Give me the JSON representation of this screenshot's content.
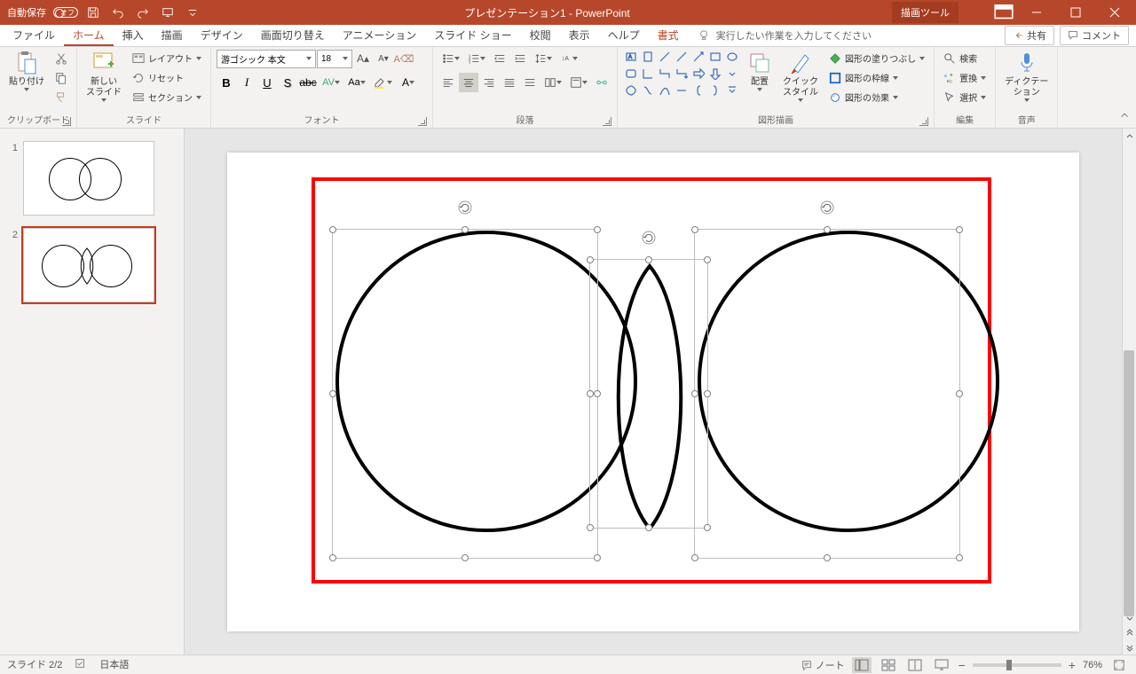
{
  "titlebar": {
    "autosave_label": "自動保存",
    "autosave_state": "オフ",
    "doc_title": "プレゼンテーション1  -  PowerPoint",
    "tools_tab": "描画ツール"
  },
  "tabs": {
    "file": "ファイル",
    "home": "ホーム",
    "insert": "挿入",
    "draw": "描画",
    "design": "デザイン",
    "transitions": "画面切り替え",
    "animations": "アニメーション",
    "slideshow": "スライド ショー",
    "review": "校閲",
    "view": "表示",
    "help": "ヘルプ",
    "format": "書式",
    "tellme": "実行したい作業を入力してください",
    "share": "共有",
    "comments": "コメント"
  },
  "ribbon": {
    "clipboard": {
      "paste": "貼り付け",
      "label": "クリップボード"
    },
    "slides": {
      "new_slide": "新しい\nスライド",
      "layout": "レイアウト",
      "reset": "リセット",
      "section": "セクション",
      "label": "スライド"
    },
    "font": {
      "name": "游ゴシック 本文",
      "size": "18",
      "label": "フォント"
    },
    "paragraph": {
      "label": "段落"
    },
    "drawing": {
      "arrange": "配置",
      "quick_styles": "クイック\nスタイル",
      "fill": "図形の塗りつぶし",
      "outline": "図形の枠線",
      "effects": "図形の効果",
      "label": "図形描画"
    },
    "editing": {
      "find": "検索",
      "replace": "置換",
      "select": "選択",
      "label": "編集"
    },
    "voice": {
      "dictate": "ディクテー\nション",
      "label": "音声"
    }
  },
  "thumbs": {
    "n1": "1",
    "n2": "2"
  },
  "status": {
    "slide": "スライド 2/2",
    "lang": "日本語",
    "notes": "ノート",
    "zoom": "76%"
  }
}
